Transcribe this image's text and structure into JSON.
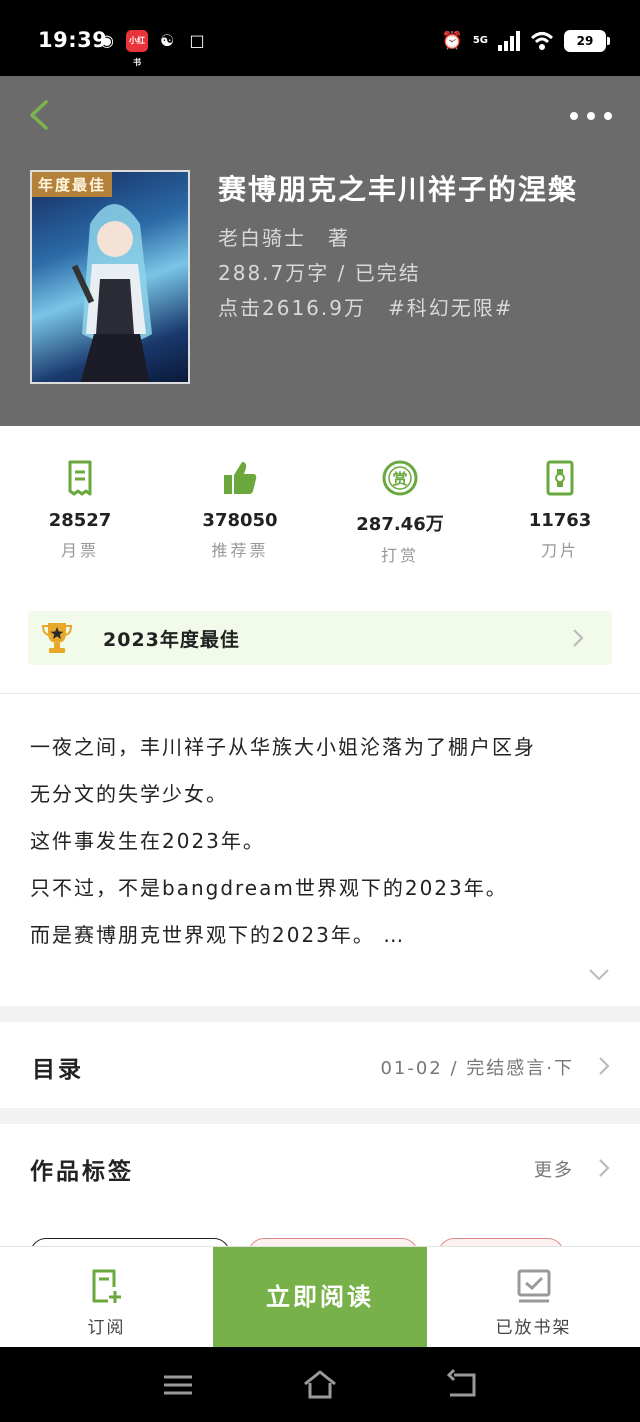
{
  "status_bar": {
    "time": "19:39",
    "apps": [
      "weibo-icon",
      "xiaohongshu-icon",
      "handshake-icon",
      "alipay-icon"
    ],
    "xiaohongshu_label": "小红书",
    "network": "5G",
    "battery": "29"
  },
  "book": {
    "title": "赛博朋克之丰川祥子的涅槃",
    "author": "老白骑士　著",
    "words_status": "288.7万字 / 已完结",
    "clicks_tag": "点击2616.9万　#科幻无限#",
    "cover_badge": "年度最佳"
  },
  "stats": [
    {
      "icon": "monthly-ticket-icon",
      "value": "28527",
      "label": "月票"
    },
    {
      "icon": "thumbs-up-icon",
      "value": "378050",
      "label": "推荐票"
    },
    {
      "icon": "reward-icon",
      "value": "287.46万",
      "label": "打赏"
    },
    {
      "icon": "blade-icon",
      "value": "11763",
      "label": "刀片"
    }
  ],
  "award": {
    "text": "2023年度最佳"
  },
  "synopsis": {
    "lines": [
      "一夜之间，丰川祥子从华族大小姐沦落为了棚户区身",
      "无分文的失学少女。",
      "这件事发生在2023年。",
      "只不过，不是bangdream世界观下的2023年。",
      "而是赛博朋克世界观下的2023年。 …"
    ]
  },
  "toc": {
    "title": "目录",
    "latest": "01-02 / 完结感言·下"
  },
  "tags": {
    "title": "作品标签",
    "more": "更多"
  },
  "actions": {
    "subscribe": "订阅",
    "read": "立即阅读",
    "shelf": "已放书架"
  },
  "colors": {
    "accent": "#78b14a",
    "header_bg": "#6b6b6b",
    "award_bg": "#f2faea"
  }
}
